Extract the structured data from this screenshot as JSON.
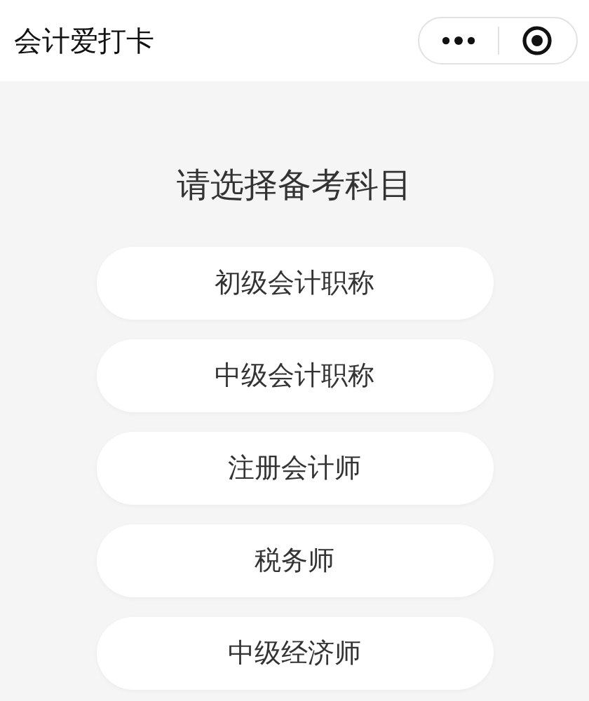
{
  "window": {
    "title": "会计爱打卡"
  },
  "heading": "请选择备考科目",
  "subjects": [
    {
      "label": "初级会计职称"
    },
    {
      "label": "中级会计职称"
    },
    {
      "label": "注册会计师"
    },
    {
      "label": "税务师"
    },
    {
      "label": "中级经济师"
    }
  ]
}
